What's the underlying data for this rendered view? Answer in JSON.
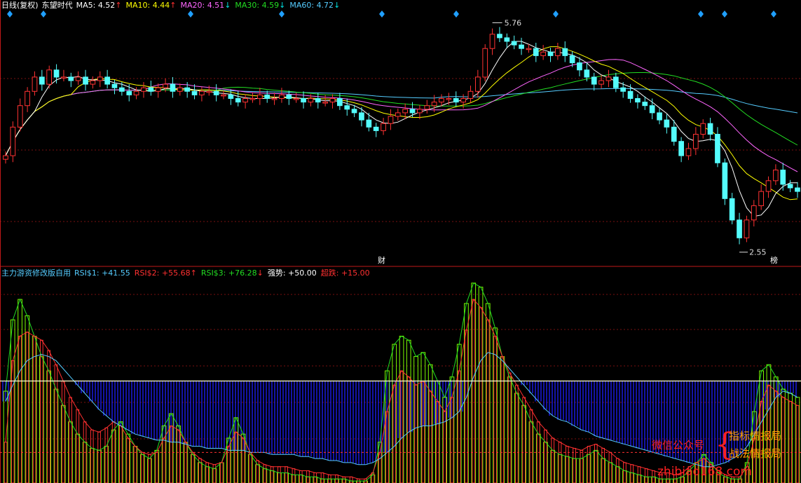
{
  "upper_header": {
    "period": "日线(复权)",
    "stock_name": "东望时代",
    "ma_items": [
      {
        "label": "MA5: ",
        "value": "4.52",
        "arrow": "↑",
        "color": "#ffffff",
        "arrow_color": "#ff3030"
      },
      {
        "label": "MA10: ",
        "value": "4.44",
        "arrow": "↑",
        "color": "#ffff00",
        "arrow_color": "#ff3030"
      },
      {
        "label": "MA20: ",
        "value": "4.51",
        "arrow": "↓",
        "color": "#ff66ff",
        "arrow_color": "#00e0e0"
      },
      {
        "label": "MA30: ",
        "value": "4.59",
        "arrow": "↓",
        "color": "#22dd22",
        "arrow_color": "#00e0e0"
      },
      {
        "label": "MA60: ",
        "value": "4.72",
        "arrow": "↓",
        "color": "#55ccff",
        "arrow_color": "#00e0e0"
      }
    ]
  },
  "lower_header": {
    "indicator_name": "主力游资修改版自用",
    "items": [
      {
        "label": "RSI$1: ",
        "value": "+41.55",
        "arrow": "",
        "color": "#55ccff"
      },
      {
        "label": "RSI$2: ",
        "value": "+55.68",
        "arrow": "↑",
        "color": "#ff3030"
      },
      {
        "label": "RSI$3: ",
        "value": "+76.28",
        "arrow": "↓",
        "color": "#22dd22"
      },
      {
        "label": "强势: ",
        "value": "+50.00",
        "arrow": "",
        "color": "#ffffff"
      },
      {
        "label": "超跌: ",
        "value": "+15.00",
        "arrow": "",
        "color": "#ff3030"
      }
    ]
  },
  "markers": {
    "high_label": "5.76",
    "low_label": "2.55",
    "cai_label": "财",
    "bang_label": "榜"
  },
  "watermark": {
    "left_text": "微信公众号",
    "brace": "{",
    "line1": "指标情报局",
    "line2": "战法情报局",
    "url": "zhibiao168.com"
  },
  "colors": {
    "up_candle": "#ff3232",
    "down_candle": "#54fcfc",
    "ma5": "#ffffff",
    "ma10": "#ffff00",
    "ma20": "#ff66ff",
    "ma30": "#22dd22",
    "ma60": "#55ccff",
    "strong_line": "#ffffcc",
    "blue_zone": "#2020ff",
    "rsi_red_bar": "#ff3030",
    "rsi_green_bar": "#7cfc00"
  },
  "chart_data": [
    {
      "type": "candlestick",
      "title": "东望时代 日线(复权)",
      "ylim": [
        2.4,
        6.0
      ],
      "high": 5.76,
      "low": 2.55,
      "last_ma": {
        "MA5": 4.52,
        "MA10": 4.44,
        "MA20": 4.51,
        "MA30": 4.59,
        "MA60": 4.72
      },
      "close_series": [
        3.9,
        4.3,
        4.6,
        4.8,
        5.0,
        4.9,
        5.1,
        5.0,
        5.0,
        4.95,
        5.0,
        4.9,
        4.95,
        5.0,
        4.9,
        4.85,
        4.8,
        4.75,
        4.8,
        4.85,
        4.8,
        4.85,
        4.9,
        4.8,
        4.85,
        4.8,
        4.75,
        4.8,
        4.8,
        4.75,
        4.75,
        4.7,
        4.65,
        4.7,
        4.7,
        4.75,
        4.7,
        4.7,
        4.75,
        4.7,
        4.7,
        4.65,
        4.7,
        4.65,
        4.65,
        4.7,
        4.6,
        4.55,
        4.5,
        4.4,
        4.3,
        4.25,
        4.35,
        4.45,
        4.5,
        4.55,
        4.5,
        4.55,
        4.6,
        4.65,
        4.7,
        4.7,
        4.65,
        4.7,
        4.8,
        5.0,
        5.4,
        5.6,
        5.55,
        5.5,
        5.45,
        5.4,
        5.4,
        5.3,
        5.35,
        5.3,
        5.4,
        5.3,
        5.2,
        5.1,
        5.0,
        4.9,
        4.95,
        5.0,
        4.85,
        4.8,
        4.7,
        4.65,
        4.6,
        4.5,
        4.4,
        4.3,
        4.1,
        3.9,
        4.0,
        4.2,
        4.35,
        4.2,
        3.8,
        3.3,
        3.0,
        2.75,
        3.0,
        3.2,
        3.4,
        3.55,
        3.7,
        3.5,
        3.45,
        3.4
      ]
    },
    {
      "type": "line",
      "title": "主力游资修改版自用",
      "ylim": [
        0,
        100
      ],
      "series": [
        {
          "name": "RSI$1",
          "last_value": 41.55,
          "values": [
            40,
            48,
            55,
            60,
            62,
            63,
            62,
            60,
            56,
            52,
            48,
            44,
            40,
            36,
            33,
            30,
            28,
            26,
            24,
            23,
            22,
            21,
            21,
            20,
            20,
            19,
            18,
            18,
            17,
            17,
            17,
            16,
            16,
            16,
            15,
            15,
            15,
            14,
            14,
            14,
            14,
            13,
            13,
            12,
            12,
            11,
            11,
            10,
            10,
            9,
            9,
            10,
            12,
            15,
            18,
            22,
            25,
            27,
            28,
            28,
            29,
            30,
            32,
            35,
            42,
            52,
            60,
            64,
            63,
            60,
            56,
            52,
            48,
            44,
            40,
            36,
            33,
            31,
            30,
            28,
            26,
            25,
            23,
            22,
            21,
            20,
            19,
            18,
            17,
            16,
            15,
            14,
            13,
            12,
            11,
            10,
            9,
            8,
            8,
            9,
            10,
            12,
            14,
            18,
            24,
            30,
            36,
            42,
            45,
            44,
            42
          ]
        },
        {
          "name": "RSI$2",
          "last_value": 55.68,
          "values": [
            20,
            60,
            72,
            74,
            72,
            70,
            65,
            58,
            50,
            42,
            36,
            30,
            26,
            25,
            27,
            30,
            28,
            22,
            18,
            15,
            14,
            15,
            22,
            28,
            26,
            20,
            15,
            12,
            10,
            9,
            10,
            18,
            25,
            22,
            15,
            11,
            9,
            8,
            8,
            8,
            7,
            6,
            6,
            5,
            5,
            4,
            4,
            3,
            3,
            2,
            2,
            5,
            15,
            35,
            48,
            55,
            52,
            48,
            50,
            45,
            40,
            35,
            42,
            55,
            75,
            90,
            86,
            80,
            72,
            62,
            54,
            48,
            42,
            36,
            30,
            26,
            22,
            20,
            18,
            17,
            16,
            18,
            19,
            17,
            15,
            12,
            10,
            9,
            8,
            7,
            6,
            5,
            5,
            4,
            5,
            8,
            10,
            12,
            9,
            6,
            4,
            3,
            3,
            8,
            22,
            40,
            48,
            45,
            42,
            40,
            38
          ]
        },
        {
          "name": "RSI$3",
          "last_value": 76.28,
          "values": [
            45,
            80,
            90,
            82,
            72,
            62,
            55,
            46,
            38,
            30,
            24,
            20,
            17,
            16,
            18,
            26,
            30,
            24,
            18,
            14,
            12,
            16,
            28,
            34,
            28,
            20,
            14,
            10,
            8,
            7,
            10,
            22,
            32,
            24,
            14,
            9,
            7,
            6,
            5,
            5,
            4,
            4,
            3,
            3,
            2,
            2,
            2,
            2,
            1,
            1,
            1,
            4,
            20,
            55,
            68,
            72,
            70,
            62,
            64,
            58,
            50,
            42,
            52,
            68,
            88,
            98,
            96,
            88,
            76,
            62,
            52,
            44,
            38,
            30,
            24,
            20,
            16,
            14,
            13,
            12,
            12,
            14,
            16,
            12,
            10,
            8,
            6,
            5,
            4,
            3,
            3,
            2,
            2,
            2,
            3,
            6,
            10,
            14,
            10,
            5,
            3,
            2,
            2,
            10,
            35,
            55,
            58,
            52,
            46,
            44,
            42
          ]
        }
      ],
      "reference_lines": [
        {
          "name": "强势",
          "value": 50.0
        },
        {
          "name": "超跌",
          "value": 15.0
        }
      ]
    }
  ]
}
